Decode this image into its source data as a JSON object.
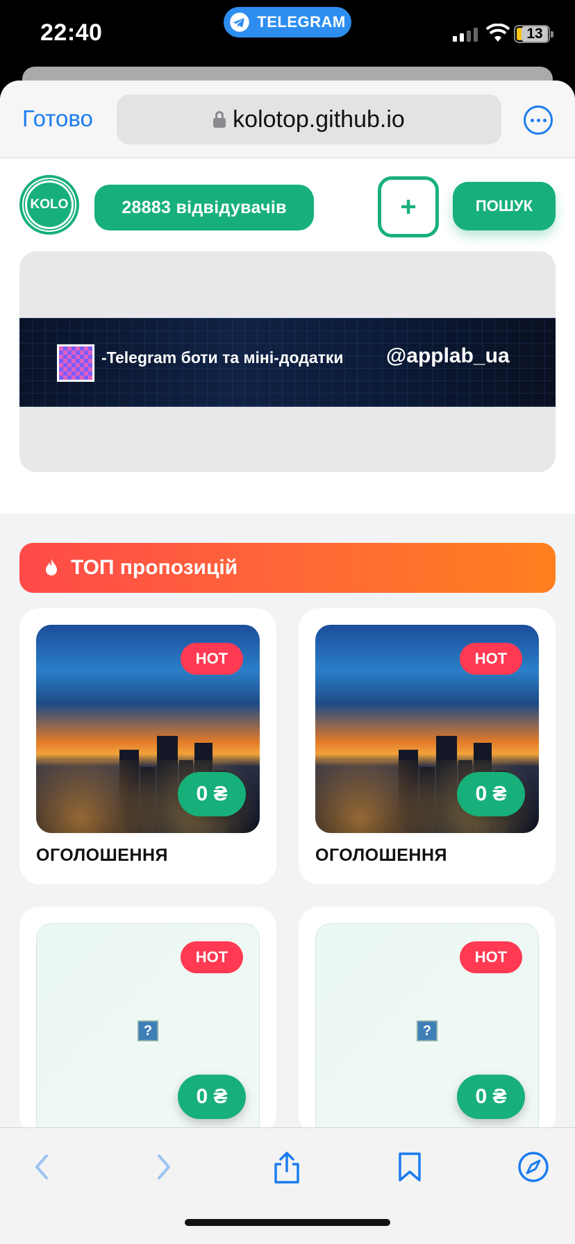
{
  "status": {
    "time": "22:40",
    "app_pill": "TELEGRAM",
    "battery": "13"
  },
  "browser": {
    "done_label": "Готово",
    "url": "kolotop.github.io"
  },
  "header": {
    "logo_text": "KOLO",
    "visitors_label": "28883 відвідувачів",
    "add_label": "+",
    "search_label": "ПОШУК"
  },
  "banner": {
    "text": "-Telegram боти та міні-додатки",
    "handle": "@applab_ua"
  },
  "top_section": {
    "title": "ТОП пропозицій"
  },
  "cards": [
    {
      "badge": "HOT",
      "price": "0 ₴",
      "title": "ОГОЛОШЕННЯ",
      "image": "city-night"
    },
    {
      "badge": "HOT",
      "price": "0 ₴",
      "title": "ОГОЛОШЕННЯ",
      "image": "city-night"
    },
    {
      "badge": "HOT",
      "price": "0 ₴",
      "title": "",
      "image": "broken-image"
    },
    {
      "badge": "HOT",
      "price": "0 ₴",
      "title": "",
      "image": "broken-image"
    }
  ],
  "toolbar": {
    "items": [
      "back-icon",
      "forward-icon",
      "share-icon",
      "bookmarks-icon",
      "compass-icon"
    ]
  },
  "colors": {
    "accent_green": "#17b07a",
    "hot_red": "#ff3a52",
    "ios_blue": "#1a7cf0"
  }
}
